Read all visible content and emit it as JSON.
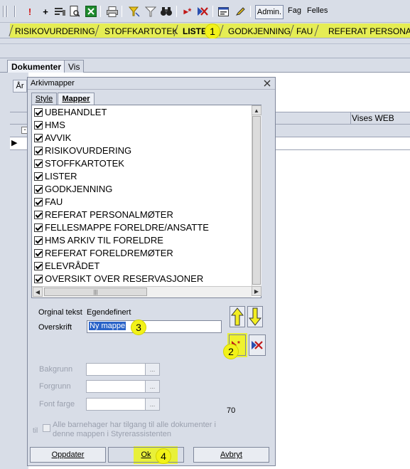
{
  "toolbar": {
    "buttons": [
      "exclamation-icon",
      "plus-icon",
      "list-edit-icon",
      "preview-icon",
      "excel-icon",
      "print-icon",
      "filter-toggle-icon",
      "filter-icon",
      "binoculars-icon",
      "new-folder-icon",
      "delete-folder-icon",
      "properties-icon",
      "pencil-icon"
    ],
    "admin": "Admin.",
    "fag": "Fag",
    "felles": "Felles"
  },
  "folder_tabs": {
    "items": [
      "RISIKOVURDERING",
      "STOFFKARTOTEK",
      "LISTE",
      "GODKJENNING",
      "FAU",
      "REFERAT PERSONALM"
    ],
    "highlight_color": "#e8f03a"
  },
  "subtabs": {
    "dokumenter": "Dokumenter",
    "vis": "Vis"
  },
  "grid": {
    "clipped_label": "År",
    "col_vises_web": "Vises WEB",
    "row_collapse": "-"
  },
  "dialog": {
    "title": "Arkivmapper",
    "tabs": [
      "Style",
      "Mapper"
    ],
    "folders": [
      "UBEHANDLET",
      "HMS",
      "AVVIK",
      "RISIKOVURDERING",
      "STOFFKARTOTEK",
      "LISTER",
      "GODKJENNING",
      "FAU",
      "REFERAT PERSONALMØTER",
      "FELLESMAPPE FORELDRE/ANSATTE",
      "HMS ARKIV TIL FORELDRE",
      "REFERAT FORELDREMØTER",
      "ELEVRÅDET",
      "OVERSIKT OVER RESERVASJONER"
    ],
    "original_text_label": "Orginal tekst",
    "original_text_value": "Egendefinert",
    "heading_label": "Overskrift",
    "heading_value": "Ny mappe",
    "background_label": "Bakgrunn",
    "foreground_label": "Forgrunn",
    "font_color_label": "Font farge",
    "number_value": "70",
    "access_checkbox_label": "Alle barnehager har tilgang til alle dokumenter i denne mappen i Styrerassistenten",
    "access_prefix": "til",
    "update_button": "Oppdater",
    "ok_button": "Ok",
    "cancel_button": "Avbryt",
    "ellipsis": "..."
  },
  "callouts": [
    "1",
    "2",
    "3",
    "4"
  ]
}
